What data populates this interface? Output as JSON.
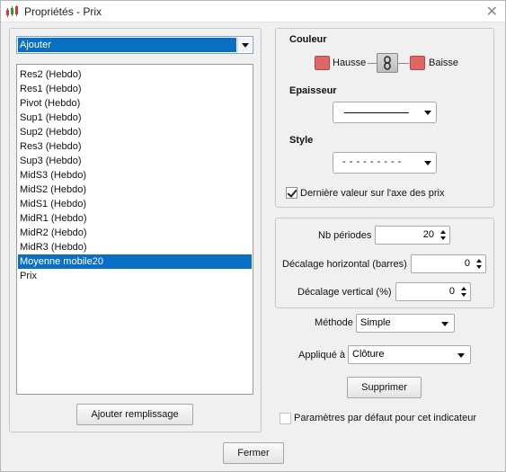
{
  "window": {
    "title": "Propriétés - Prix"
  },
  "left": {
    "dropdown_value": "Ajouter",
    "items": [
      "Res2 (Hebdo)",
      "Res1 (Hebdo)",
      "Pivot (Hebdo)",
      "Sup1 (Hebdo)",
      "Sup2 (Hebdo)",
      "Res3 (Hebdo)",
      "Sup3 (Hebdo)",
      "MidS3 (Hebdo)",
      "MidS2 (Hebdo)",
      "MidS1 (Hebdo)",
      "MidR1 (Hebdo)",
      "MidR2 (Hebdo)",
      "MidR3 (Hebdo)",
      "Moyenne mobile20",
      "Prix"
    ],
    "selected_index": 13,
    "add_fill_button": "Ajouter remplissage"
  },
  "style_panel": {
    "color_heading": "Couleur",
    "up_label": "Hausse",
    "down_label": "Baisse",
    "up_color": "#e06666",
    "down_color": "#e06666",
    "thickness_heading": "Epaisseur",
    "style_heading": "Style",
    "style_value": "- - - - - - - - -",
    "last_value_label": "Dernière valeur sur l'axe des prix",
    "last_value_checked": true
  },
  "params": {
    "periods_label": "Nb périodes",
    "periods_value": "20",
    "hshift_label": "Décalage horizontal (barres)",
    "hshift_value": "0",
    "vshift_label": "Décalage vertical (%)",
    "vshift_value": "0"
  },
  "method": {
    "label": "Méthode",
    "value": "Simple"
  },
  "applied": {
    "label": "Appliqué à",
    "value": "Clôture"
  },
  "delete_button": "Supprimer",
  "default_params_label": "Paramètres par défaut pour cet indicateur",
  "close_button": "Fermer"
}
